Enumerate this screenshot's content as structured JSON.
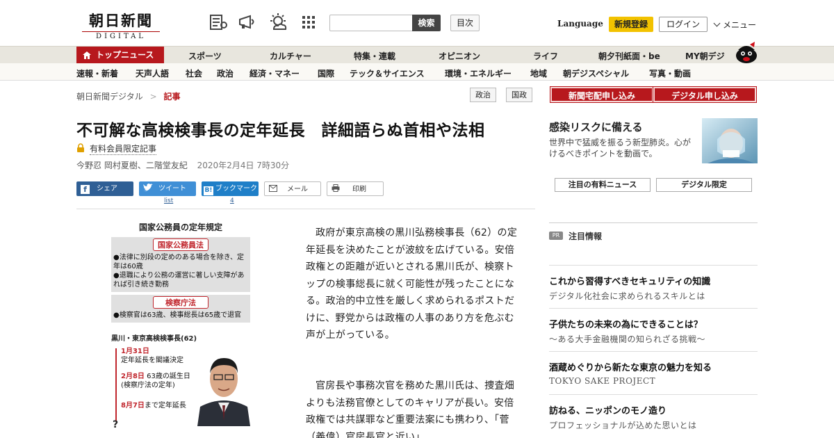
{
  "header": {
    "logo_main": "朝日新聞",
    "logo_sub": "DIGITAL",
    "search_button": "検索",
    "toc_button": "目次",
    "language": "Language",
    "register": "新規登録",
    "login": "ログイン",
    "menu": "メニュー"
  },
  "main_nav": {
    "active": "トップニュース",
    "items": [
      "スポーツ",
      "カルチャー",
      "特集・連載",
      "オピニオン",
      "ライフ",
      "朝夕刊紙面・be",
      "MY朝デジ"
    ]
  },
  "sub_nav": {
    "items": [
      "速報・新着",
      "天声人語",
      "社会",
      "政治",
      "経済・マネー",
      "国際",
      "テック＆サイエンス",
      "環境・エネルギー",
      "地域",
      "朝デジスペシャル",
      "写真・動画"
    ]
  },
  "breadcrumb": {
    "home": "朝日新聞デジタル",
    "separator": ">",
    "current": "記事"
  },
  "tags": [
    "政治",
    "国政"
  ],
  "article": {
    "title": "不可解な高検検事長の定年延長　詳細語らぬ首相や法相",
    "locked_label": "有料会員限定記事",
    "byline": "今野忍 岡村夏樹、二階堂友紀",
    "date": "2020年2月4日 7時30分",
    "paragraph_1": "政府が東京高検の黒川弘務検事長（62）の定年延長を決めたことが波紋を広げている。安倍政権との距離が近いとされる黒川氏が、検察トップの検事総長に就く可能性が残ったことになる。政治的中立性を厳しく求められるポストだけに、野党からは政権の人事のあり方を危ぶむ声が上がっている。",
    "paragraph_2": "官房長や事務次官を務めた黒川氏は、捜査畑よりも法務官僚としてのキャリアが長い。安倍政権では共謀罪など重要法案にも携わり、「菅（義偉）官房長官と近い」"
  },
  "share": {
    "facebook": "シェア",
    "twitter": "ツイート",
    "twitter_count": "list",
    "hatena": "ブックマーク",
    "hatena_count": "4",
    "mail": "メール",
    "print": "印刷"
  },
  "figure": {
    "title": "国家公務員の定年規定",
    "law1_head": "国家公務員法",
    "law1_text1": "●法律に別段の定めのある場合を除き、定年は60歳",
    "law1_text2": "●退職により公務の運営に著しい支障があれば引き続き勤務",
    "law2_head": "検察庁法",
    "law2_text": "●検察官は63歳、検事総長は65歳で退官",
    "person": "黒川・東京高検検事長(62)",
    "d1": "1月31日",
    "d1_text": "定年延長を閣議決定",
    "d2": "2月8日",
    "d2_text": "63歳の誕生日",
    "d2_note": "(検察庁法の定年)",
    "d3": "8月7日",
    "d3_text": "まで定年延長",
    "unknown": "?"
  },
  "sidebar": {
    "cta_home": "新聞宅配申し込み",
    "cta_digital": "デジタル申し込み",
    "promo_title": "感染リスクに備える",
    "promo_desc": "世界中で猛威を振るう新型肺炎。心がけるべきポイントを動画で。",
    "tab1": "注目の有料ニュース",
    "tab2": "デジタル限定",
    "pr_badge": "PR",
    "pr_label": "注目情報",
    "ads": [
      {
        "title": "これから習得すべきセキュリティの知識",
        "desc": "デジタル化社会に求められるスキルとは"
      },
      {
        "title": "子供たちの未来の為にできることは？",
        "desc": "～ある大手金融機関の知られざる挑戦～"
      },
      {
        "title": "酒蔵めぐりから新たな東京の魅力を知る",
        "desc": "TOKYO SAKE PROJECT"
      },
      {
        "title": "訪ねる、ニッポンのモノ造り",
        "desc": "プロフェッショナルが込めた思いとは"
      }
    ]
  },
  "colors": {
    "brand_red": "#b7181d",
    "register_yellow": "#f2c200",
    "nav_bg": "#e8e6de"
  }
}
